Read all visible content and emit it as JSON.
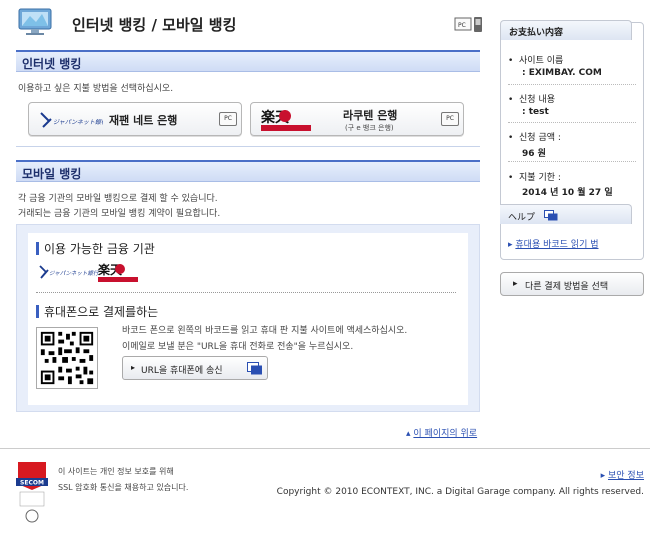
{
  "header": {
    "title": "인터넷 뱅킹 / 모바일 뱅킹",
    "pc_badge": "PC"
  },
  "internet": {
    "heading": "인터넷 뱅킹",
    "instruction": "이용하고 싶은 지불 방법을 선택하십시오.",
    "japannet": {
      "logo_text": "ジャパンネット銀行",
      "label": "재팬 네트 은행",
      "badge": "PC"
    },
    "rakuten": {
      "logo_text": "楽天",
      "label": "라쿠텐 은행",
      "sub": "(구 e 뱅크 은행)",
      "badge": "PC"
    }
  },
  "mobile": {
    "heading": "모바일 뱅킹",
    "desc1": "각 금융 기관의 모바일 뱅킹으로 결제 할 수 있습니다.",
    "desc2": "거래되는 금융 기관의 모바일 뱅킹 계약이 필요합니다.",
    "available_title": "이용 가능한 금융 기관",
    "available_logo_jnb": "ジャパンネット銀行",
    "available_logo_rakuten": "楽天",
    "phone_title": "휴대폰으로 결제를하는",
    "phone_text1": "바코드 폰으로 왼쪽의 바코드를 읽고 휴대 판 지불 사이트에 액세스하십시오.",
    "phone_text2": "이메일로 보낼 분은 \"URL을 휴대 전화로 전송\"을 누르십시오.",
    "send_button": "URL을 휴대폰에 송신"
  },
  "page_top_link": "이 페이지의 위로",
  "summary": {
    "tab": "お支払い内容",
    "site_name_label": "사이트 이름",
    "site_name_value": ": EXIMBAY. COM",
    "content_label": "신청 내용",
    "content_value": ": test",
    "amount_label": "신청 금액 :",
    "amount_value": "96 원",
    "deadline_label": "지불 기한 :",
    "deadline_value": "2014 년 10 월 27 일"
  },
  "help": {
    "tab": "ヘルプ",
    "link": "휴대용 바코드 읽기 법"
  },
  "other_method_button": "다른 결제 방법을 선택",
  "footer": {
    "secom_badge": "SECOM",
    "privacy1": "이 사이트는 개인 정보 보호를 위해",
    "privacy2": "SSL 암호화 통신을 채용하고 있습니다.",
    "security_link": "보안 정보",
    "copyright": "Copyright © 2010 ECONTEXT, INC. a Digital Garage company. All rights reserved."
  },
  "colors": {
    "accent": "#3a5fc0",
    "link": "#2a4fb2",
    "panel_bg": "#e8eefa",
    "rakuten_red": "#c8102e",
    "secom_red": "#d71920"
  }
}
